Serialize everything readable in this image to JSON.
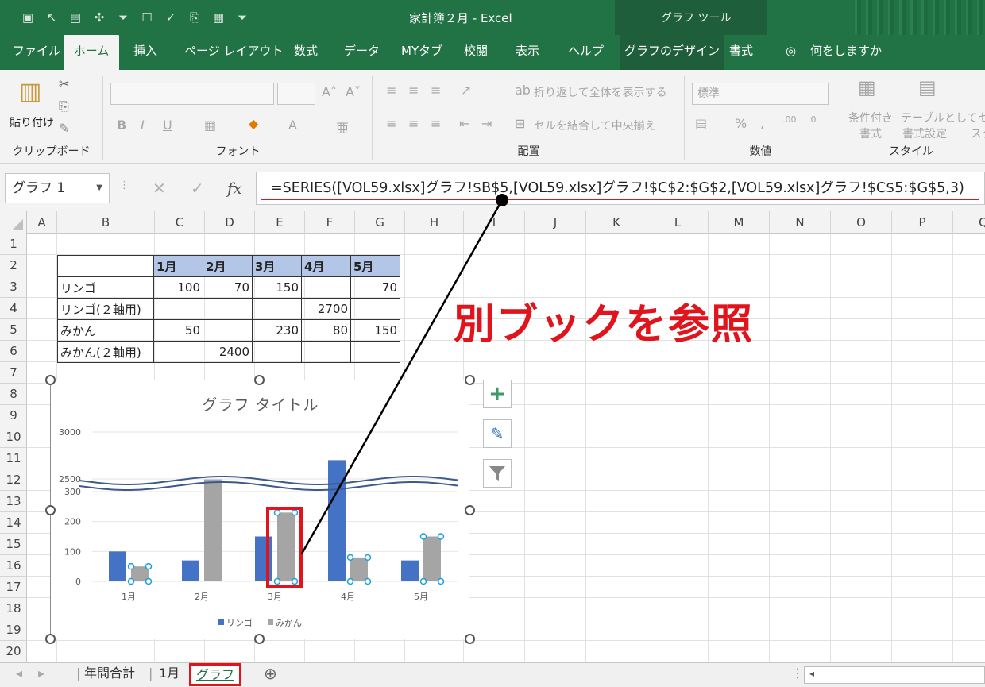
{
  "window": {
    "title": "家計簿２月 - Excel",
    "context_tab_group": "グラフ ツール"
  },
  "qat_icons": [
    "save-icon",
    "pointer-icon",
    "print-preview-icon",
    "crosshair-icon",
    "filter-icon",
    "comment-icon",
    "check-icon",
    "fx-check-icon",
    "table-icon",
    "customize-icon"
  ],
  "tabs": [
    {
      "label": "ファイル"
    },
    {
      "label": "ホーム"
    },
    {
      "label": "挿入"
    },
    {
      "label": "ページ レイアウト"
    },
    {
      "label": "数式"
    },
    {
      "label": "データ"
    },
    {
      "label": "MYタブ"
    },
    {
      "label": "校閲"
    },
    {
      "label": "表示"
    },
    {
      "label": "ヘルプ"
    },
    {
      "label": "グラフのデザイン"
    },
    {
      "label": "書式"
    },
    {
      "label": "何をしますか"
    }
  ],
  "ribbon": {
    "clipboard": {
      "paste": "貼り付け",
      "group": "クリップボード"
    },
    "font": {
      "group": "フォント"
    },
    "alignment": {
      "wrap": "折り返して全体を表示する",
      "merge": "セルを結合して中央揃え",
      "group": "配置"
    },
    "number": {
      "format": "標準",
      "group": "数値"
    },
    "styles": {
      "cond1": "条件付き",
      "cond2": "書式",
      "table1": "テーブルとして",
      "table2": "書式設定",
      "cell": "セ",
      "cell2": "スタ",
      "group": "スタイル"
    }
  },
  "formula_bar": {
    "name_box": "グラフ 1",
    "formula": "=SERIES([VOL59.xlsx]グラフ!$B$5,[VOL59.xlsx]グラフ!$C$2:$G$2,[VOL59.xlsx]グラフ!$C$5:$G$5,3)"
  },
  "columns": [
    "A",
    "B",
    "C",
    "D",
    "E",
    "F",
    "G",
    "H",
    "I",
    "J",
    "K",
    "L",
    "M",
    "N",
    "O",
    "P",
    "Q"
  ],
  "rows": [
    "1",
    "2",
    "3",
    "4",
    "5",
    "6",
    "7",
    "8",
    "9",
    "10",
    "11",
    "12",
    "13",
    "14",
    "15",
    "16",
    "17",
    "18",
    "19",
    "20"
  ],
  "table": {
    "header": [
      "",
      "1月",
      "2月",
      "3月",
      "4月",
      "5月"
    ],
    "rows": [
      [
        "リンゴ",
        "100",
        "70",
        "150",
        "",
        "70"
      ],
      [
        "リンゴ(２軸用)",
        "",
        "",
        "",
        "2700",
        ""
      ],
      [
        "みかん",
        "50",
        "",
        "230",
        "80",
        "150"
      ],
      [
        "みかん(２軸用)",
        "",
        "2400",
        "",
        "",
        ""
      ]
    ]
  },
  "callout": "別ブックを参照",
  "chart_data": {
    "type": "bar",
    "title": "グラフ タイトル",
    "categories": [
      "1月",
      "2月",
      "3月",
      "4月",
      "5月"
    ],
    "series": [
      {
        "name": "リンゴ",
        "color": "#4472c4",
        "values": [
          100,
          70,
          150,
          2700,
          70
        ]
      },
      {
        "name": "みかん",
        "color": "#a5a5a5",
        "values": [
          50,
          2400,
          230,
          80,
          150
        ]
      }
    ],
    "yticks": [
      "0",
      "100",
      "200",
      "300",
      "2500",
      "3000"
    ],
    "axis_break": true,
    "legend": "bottom"
  },
  "sheets": {
    "tabs": [
      "年間合計",
      "1月",
      "グラフ"
    ],
    "active": "グラフ"
  }
}
